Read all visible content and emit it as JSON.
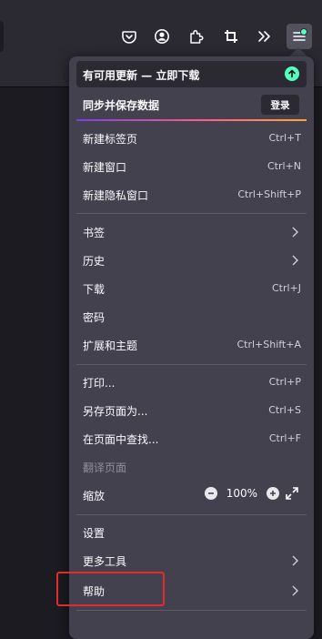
{
  "toolbar": {
    "buttons": [
      {
        "icon": "pocket-icon"
      },
      {
        "icon": "account-icon"
      },
      {
        "icon": "extensions-icon"
      },
      {
        "icon": "screenshot-icon"
      },
      {
        "icon": "overflow-icon"
      },
      {
        "icon": "hamburger-menu-icon",
        "active": true
      }
    ]
  },
  "menu": {
    "update_banner": "有可用更新 — 立即下载",
    "sync_label": "同步并保存数据",
    "login_button": "登录",
    "items": [
      {
        "label": "新建标签页",
        "shortcut": "Ctrl+T"
      },
      {
        "label": "新建窗口",
        "shortcut": "Ctrl+N"
      },
      {
        "label": "新建隐私窗口",
        "shortcut": "Ctrl+Shift+P"
      },
      {
        "label": "书签",
        "submenu": true
      },
      {
        "label": "历史",
        "submenu": true
      },
      {
        "label": "下载",
        "shortcut": "Ctrl+J"
      },
      {
        "label": "密码"
      },
      {
        "label": "扩展和主题",
        "shortcut": "Ctrl+Shift+A"
      },
      {
        "label": "打印...",
        "shortcut": "Ctrl+P"
      },
      {
        "label": "另存页面为...",
        "shortcut": "Ctrl+S"
      },
      {
        "label": "在页面中查找...",
        "shortcut": "Ctrl+F"
      },
      {
        "label": "翻译页面",
        "disabled": true
      },
      {
        "label": "缩放",
        "zoom": "100%"
      },
      {
        "label": "设置"
      },
      {
        "label": "更多工具",
        "submenu": true
      },
      {
        "label": "帮助",
        "submenu": true,
        "highlighted": true
      }
    ]
  },
  "colors": {
    "menu_bg": "#42414d",
    "toolbar_bg": "#2b2a33",
    "accent_green": "#54ffbd",
    "highlight_red": "#e42b2b"
  }
}
